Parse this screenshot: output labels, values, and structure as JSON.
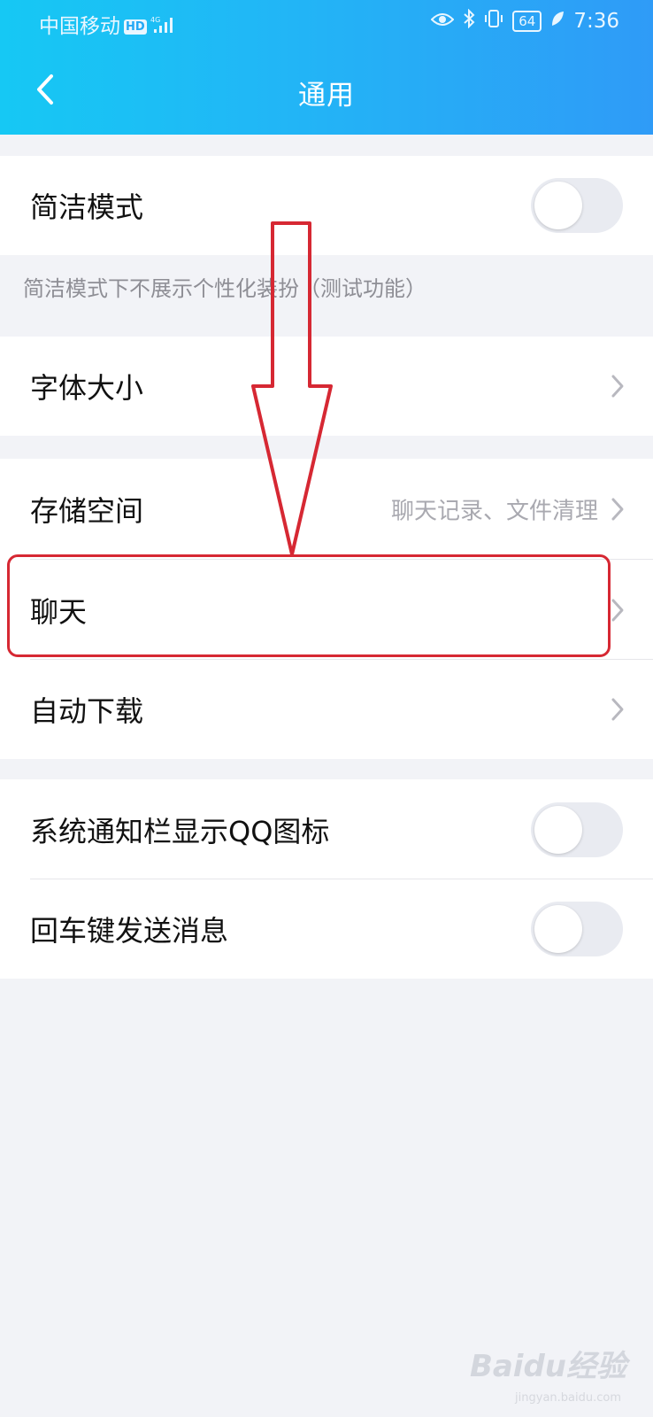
{
  "status_bar": {
    "carrier": "中国移动",
    "hd_badge": "HD",
    "network": "4G",
    "battery": "64",
    "time": "7:36"
  },
  "header": {
    "title": "通用"
  },
  "settings": {
    "simple_mode": {
      "label": "简洁模式",
      "enabled": false
    },
    "simple_mode_hint": "简洁模式下不展示个性化装扮（测试功能）",
    "font_size": {
      "label": "字体大小"
    },
    "storage": {
      "label": "存储空间",
      "value": "聊天记录、文件清理"
    },
    "chat": {
      "label": "聊天"
    },
    "auto_download": {
      "label": "自动下载"
    },
    "notification_qq_icon": {
      "label": "系统通知栏显示QQ图标",
      "enabled": false
    },
    "enter_to_send": {
      "label": "回车键发送消息",
      "enabled": false
    }
  },
  "annotation": {
    "highlight_color": "#d62833"
  },
  "watermark": {
    "text": "Baidu经验",
    "sub": "jingyan.baidu.com"
  },
  "colors": {
    "header_start": "#16c8f4",
    "header_end": "#2f9bf7",
    "background": "#f2f3f7"
  }
}
